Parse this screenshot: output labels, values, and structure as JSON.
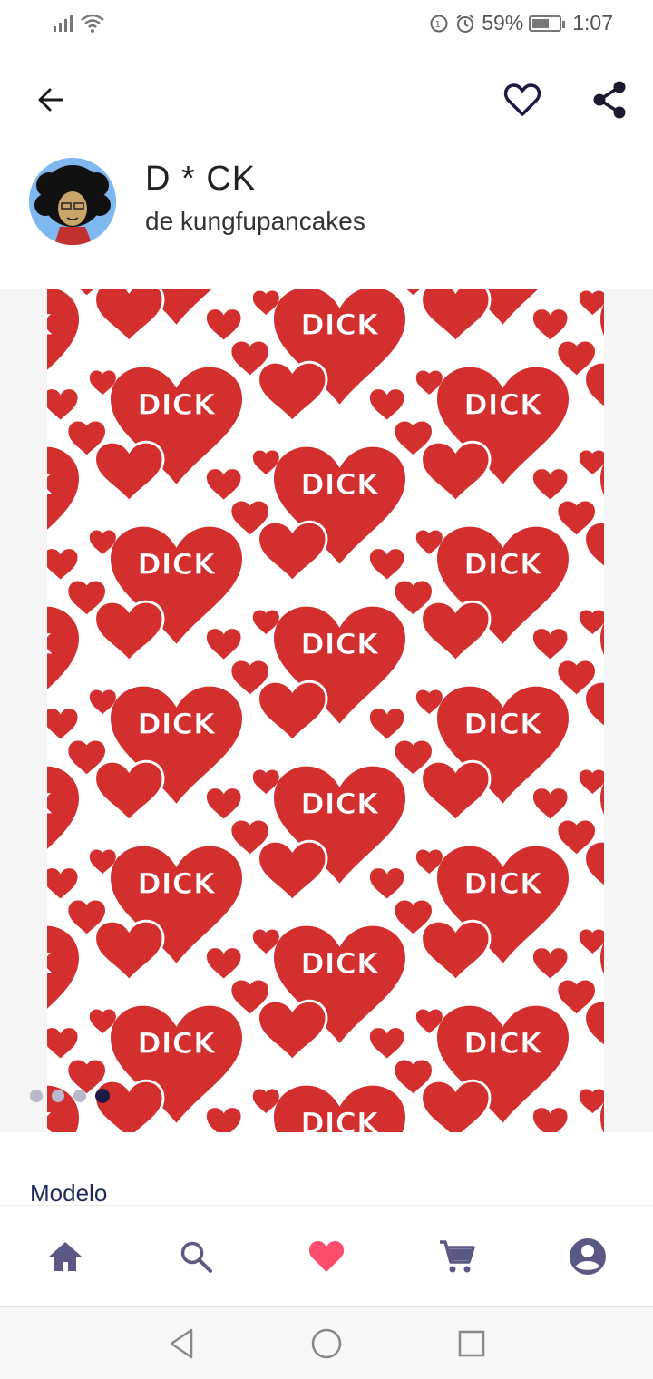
{
  "status": {
    "battery": "59%",
    "battery_level": 0.59,
    "time": "1:07"
  },
  "header": {
    "title": "D * CK",
    "byline": "de kungfupancakes"
  },
  "gallery": {
    "pattern_text": "DICK",
    "page_count": 4,
    "active_page": 4
  },
  "section": {
    "label": "Modelo"
  },
  "bottom_nav": {
    "items": [
      {
        "icon": "home-icon",
        "active": false
      },
      {
        "icon": "search-icon",
        "active": false
      },
      {
        "icon": "heart-icon",
        "active": true
      },
      {
        "icon": "cart-icon",
        "active": false
      },
      {
        "icon": "account-icon",
        "active": false
      }
    ]
  },
  "colors": {
    "accent": "#1a1a44",
    "heart_red": "#d32f2f",
    "nav_icon": "#5a5885",
    "favorite_pink": "#ff4d6d"
  }
}
